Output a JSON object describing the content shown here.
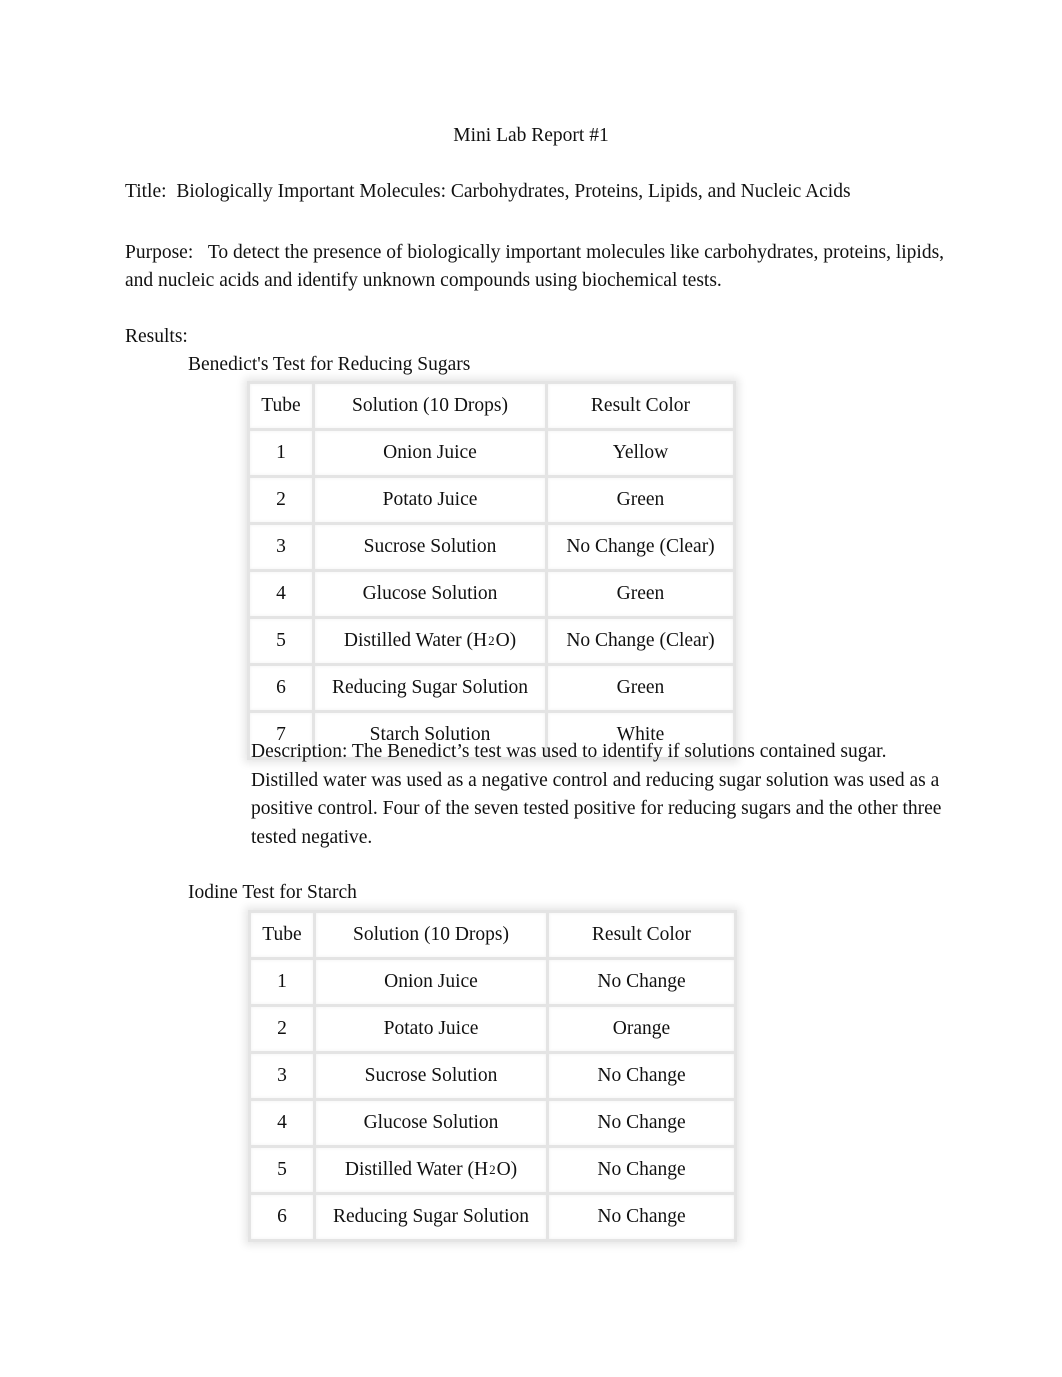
{
  "doc_title": "Mini Lab Report #1",
  "title": {
    "label": "Title:",
    "text": "Biologically Important Molecules: Carbohydrates, Proteins, Lipids, and Nucleic Acids"
  },
  "purpose": {
    "label": "Purpose:",
    "text": "To detect the presence of biologically important molecules like carbohydrates, proteins, lipids, and nucleic acids and identify unknown compounds using biochemical tests."
  },
  "results_label": "Results:",
  "benedict": {
    "heading": "Benedict's Test for Reducing Sugars",
    "columns": [
      "Tube",
      "Solution (10 Drops)",
      "Result Color"
    ],
    "rows": [
      {
        "tube": "1",
        "solution": "Onion Juice",
        "result": "Yellow"
      },
      {
        "tube": "2",
        "solution": "Potato Juice",
        "result": "Green"
      },
      {
        "tube": "3",
        "solution": "Sucrose Solution",
        "result": "No Change (Clear)"
      },
      {
        "tube": "4",
        "solution": "Glucose Solution",
        "result": "Green"
      },
      {
        "tube": "5",
        "solution": "Distilled Water (H2O)",
        "result": "No Change (Clear)"
      },
      {
        "tube": "6",
        "solution": "Reducing Sugar Solution",
        "result": "Green"
      },
      {
        "tube": "7",
        "solution": "Starch Solution",
        "result": "White"
      }
    ],
    "description": "Description: The Benedict’s test was used to identify if solutions contained sugar. Distilled water was used as a negative control and reducing sugar solution was used as a positive control. Four of the seven tested positive for reducing sugars and the other three tested negative."
  },
  "iodine": {
    "heading": "Iodine Test for Starch",
    "columns": [
      "Tube",
      "Solution (10 Drops)",
      "Result Color"
    ],
    "rows": [
      {
        "tube": "1",
        "solution": "Onion Juice",
        "result": "No Change"
      },
      {
        "tube": "2",
        "solution": "Potato Juice",
        "result": "Orange"
      },
      {
        "tube": "3",
        "solution": "Sucrose Solution",
        "result": "No Change"
      },
      {
        "tube": "4",
        "solution": "Glucose Solution",
        "result": "No Change"
      },
      {
        "tube": "5",
        "solution": "Distilled Water (H2O)",
        "result": "No Change"
      },
      {
        "tube": "6",
        "solution": "Reducing Sugar Solution",
        "result": "No Change"
      }
    ]
  }
}
